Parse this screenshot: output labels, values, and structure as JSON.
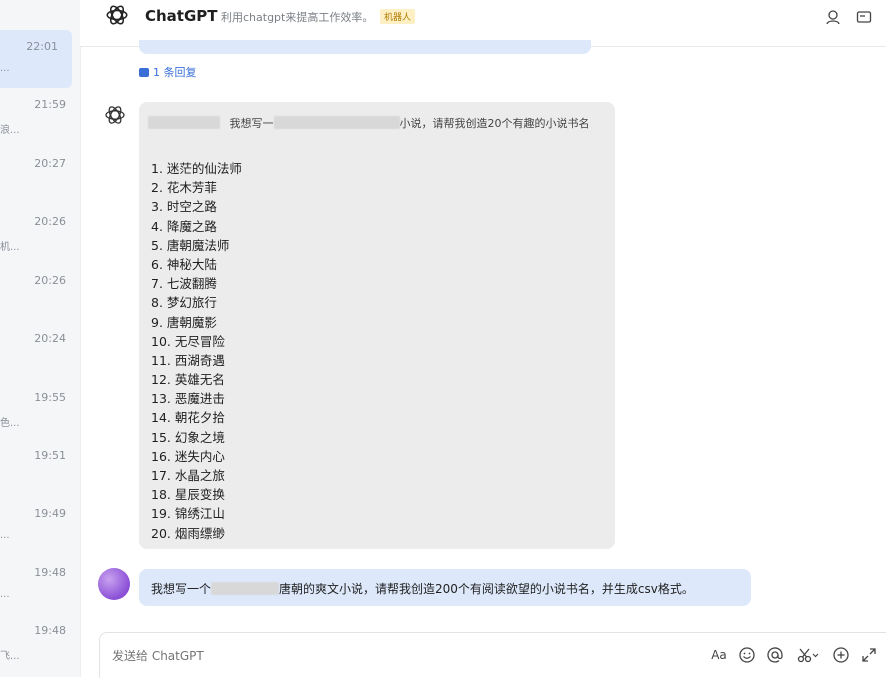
{
  "header": {
    "title": "ChatGPT",
    "subtitle": "利用chatgpt来提高工作效率。",
    "badge": "机器人"
  },
  "sidebar": {
    "items": [
      {
        "time": "22:01",
        "snippet": "...",
        "active": true
      },
      {
        "time": "21:59",
        "snippet": "浪..."
      },
      {
        "time": "20:27",
        "snippet": ""
      },
      {
        "time": "20:26",
        "snippet": "机..."
      },
      {
        "time": "20:26",
        "snippet": ""
      },
      {
        "time": "20:24",
        "snippet": ""
      },
      {
        "time": "19:55",
        "snippet": "色..."
      },
      {
        "time": "19:51",
        "snippet": ""
      },
      {
        "time": "19:49",
        "snippet": "..."
      },
      {
        "time": "19:48",
        "snippet": "..."
      },
      {
        "time": "19:48",
        "snippet": "飞..."
      }
    ]
  },
  "thread": {
    "reply_link": "1 条回复",
    "bot_message": {
      "prompt_part1": "我想写一",
      "prompt_part2": "小说，请帮我创造20个有趣的小说书名",
      "titles": [
        "1. 迷茫的仙法师",
        "2. 花木芳菲",
        "3. 时空之路",
        "4. 降魔之路",
        "5. 唐朝魔法师",
        "6. 神秘大陆",
        "7. 七波翻腾",
        "8. 梦幻旅行",
        "9. 唐朝魔影",
        "10. 无尽冒险",
        "11. 西湖奇遇",
        "12. 英雄无名",
        "13. 恶魔进击",
        "14. 朝花夕拾",
        "15. 幻象之境",
        "16. 迷失内心",
        "17. 水晶之旅",
        "18. 星辰变换",
        "19. 锦绣江山",
        "20. 烟雨缥缈"
      ]
    },
    "user_message": {
      "part1": "我想写一个",
      "part2": "唐朝的爽文小说，请帮我创造200个有阅读欲望的小说书名，并生成csv格式。"
    }
  },
  "input": {
    "placeholder": "发送给 ChatGPT",
    "font_button": "Aa"
  },
  "colors": {
    "user_bubble": "#dde9fb",
    "bot_bubble": "#ececec",
    "link": "#3a6fd8"
  }
}
